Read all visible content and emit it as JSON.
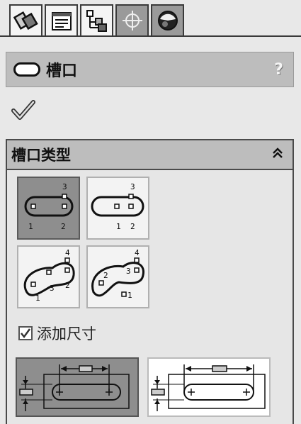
{
  "panel": {
    "title": "槽口",
    "help": "?"
  },
  "tabs": [
    {
      "icon": "feature-manager-icon"
    },
    {
      "icon": "property-manager-icon"
    },
    {
      "icon": "configuration-manager-icon"
    },
    {
      "icon": "dim-xpert-icon"
    },
    {
      "icon": "display-manager-icon"
    }
  ],
  "group": {
    "title": "槽口类型",
    "collapse": "≈"
  },
  "slot_types": [
    {
      "id": "straight-slot",
      "selected": true
    },
    {
      "id": "center-straight-slot",
      "selected": false
    },
    {
      "id": "three-point-arc-slot",
      "selected": false
    },
    {
      "id": "center-arc-slot",
      "selected": false
    }
  ],
  "add_dimensions": {
    "label": "添加尺寸",
    "checked": true
  },
  "dimension_types": [
    {
      "id": "center-to-center",
      "selected": true
    },
    {
      "id": "overall-length",
      "selected": false
    }
  ],
  "colors": {
    "header": "#bdbdbd",
    "panel": "#e8e8e8",
    "selected": "#8e8e8e"
  }
}
